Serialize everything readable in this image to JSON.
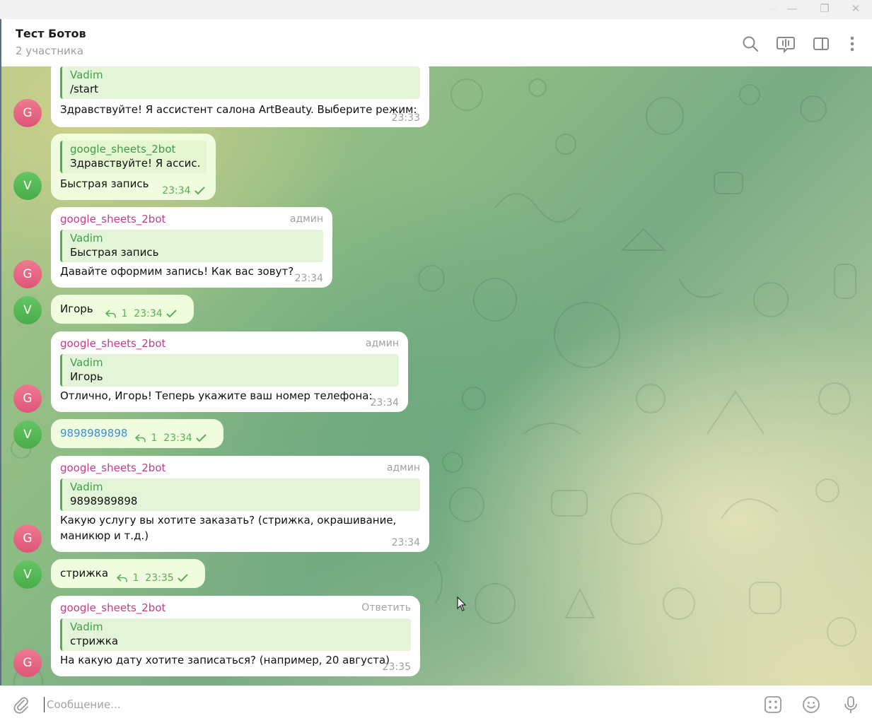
{
  "window": {
    "minimize_dim": "—",
    "minimize": "—",
    "maximize": "❐",
    "close": "✕"
  },
  "header": {
    "title": "Тест Ботов",
    "subtitle": "2 участника"
  },
  "messages": [
    {
      "side": "in",
      "avatar": "G",
      "quote_name": "Vadim",
      "quote_text": "/start",
      "text": "Здравствуйте! Я ассистент салона ArtBeauty. Выберите режим:",
      "time": "23:33"
    },
    {
      "side": "out",
      "avatar": "V",
      "quote_name": "google_sheets_2bot",
      "quote_text": "Здравствуйте! Я ассис...",
      "text": "Быстрая запись",
      "time": "23:34"
    },
    {
      "side": "in",
      "avatar": "G",
      "sender": "google_sheets_2bot",
      "badge": "админ",
      "quote_name": "Vadim",
      "quote_text": "Быстрая запись",
      "text": "Давайте оформим запись! Как вас зовут?",
      "time": "23:34"
    },
    {
      "side": "out",
      "avatar": "V",
      "text": "Игорь",
      "replies": "1",
      "time": "23:34"
    },
    {
      "side": "in",
      "avatar": "G",
      "sender": "google_sheets_2bot",
      "badge": "админ",
      "quote_name": "Vadim",
      "quote_text": "Игорь",
      "text": "Отлично, Игорь! Теперь укажите ваш номер телефона:",
      "time": "23:34"
    },
    {
      "side": "out",
      "avatar": "V",
      "text": "9898989898",
      "replies": "1",
      "time": "23:34"
    },
    {
      "side": "in",
      "avatar": "G",
      "sender": "google_sheets_2bot",
      "badge": "админ",
      "quote_name": "Vadim",
      "quote_text": "9898989898",
      "text_line1": "Какую услугу вы хотите заказать? (стрижка, окрашивание,",
      "text_line2": "маникюр и т.д.)",
      "time": "23:34"
    },
    {
      "side": "out",
      "avatar": "V",
      "text": "стрижка",
      "replies": "1",
      "time": "23:35"
    },
    {
      "side": "in",
      "avatar": "G",
      "sender": "google_sheets_2bot",
      "badge": "Ответить",
      "quote_name": "Vadim",
      "quote_text": "стрижка",
      "text": "На какую дату хотите записаться? (например, 20 августа)",
      "time": "23:35"
    }
  ],
  "composer": {
    "placeholder": "Сообщение..."
  },
  "icons": {
    "header": [
      "search-icon",
      "voice-chat-icon",
      "sidebar-toggle-icon",
      "more-icon"
    ],
    "composer": [
      "attach-icon",
      "bot-commands-icon",
      "emoji-icon",
      "microphone-icon"
    ]
  },
  "colors": {
    "sender": "#c03d82",
    "quote_name": "#3fa047",
    "out_bubble": "#effdde",
    "link": "#3c8fd0",
    "avatar_g": "#e46582",
    "avatar_v": "#56b957"
  }
}
